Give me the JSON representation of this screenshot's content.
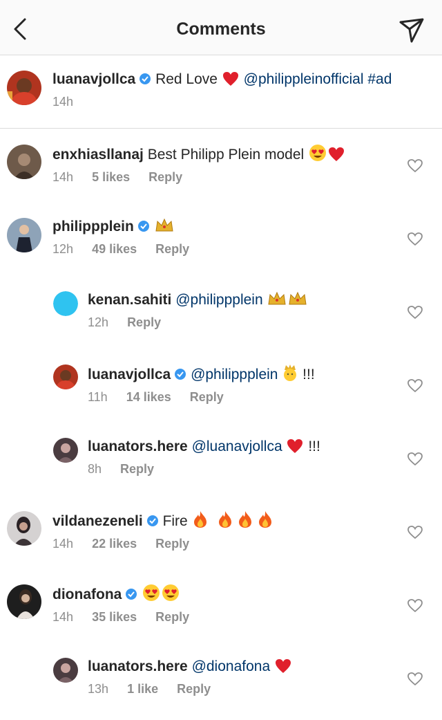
{
  "header": {
    "title": "Comments"
  },
  "caption": {
    "username": "luanavjollca",
    "text": "Red Love",
    "mention": "@philippleinofficial",
    "hashtag": "#ad",
    "time": "14h"
  },
  "comments": [
    {
      "username": "enxhiasllanaj",
      "text": "Best Philipp Plein model",
      "time": "14h",
      "likes": "5 likes",
      "reply": "Reply"
    },
    {
      "username": "philippplein",
      "text": "",
      "time": "12h",
      "likes": "49 likes",
      "reply": "Reply"
    },
    {
      "username": "kenan.sahiti",
      "mention": "@philippplein",
      "time": "12h",
      "likes": "",
      "reply": "Reply"
    },
    {
      "username": "luanavjollca",
      "mention": "@philippplein",
      "suffix": "!!!",
      "time": "11h",
      "likes": "14 likes",
      "reply": "Reply"
    },
    {
      "username": "luanators.here",
      "mention": "@luanavjollca",
      "suffix": "!!!",
      "time": "8h",
      "likes": "",
      "reply": "Reply"
    },
    {
      "username": "vildanezeneli",
      "text": "Fire",
      "time": "14h",
      "likes": "22 likes",
      "reply": "Reply"
    },
    {
      "username": "dionafona",
      "text": "",
      "time": "14h",
      "likes": "35 likes",
      "reply": "Reply"
    },
    {
      "username": "luanators.here",
      "mention": "@dionafona",
      "time": "13h",
      "likes": "1 like",
      "reply": "Reply"
    }
  ],
  "colors": {
    "verified": "#3897f0",
    "mention": "#003569",
    "meta": "#8e8e8e"
  }
}
